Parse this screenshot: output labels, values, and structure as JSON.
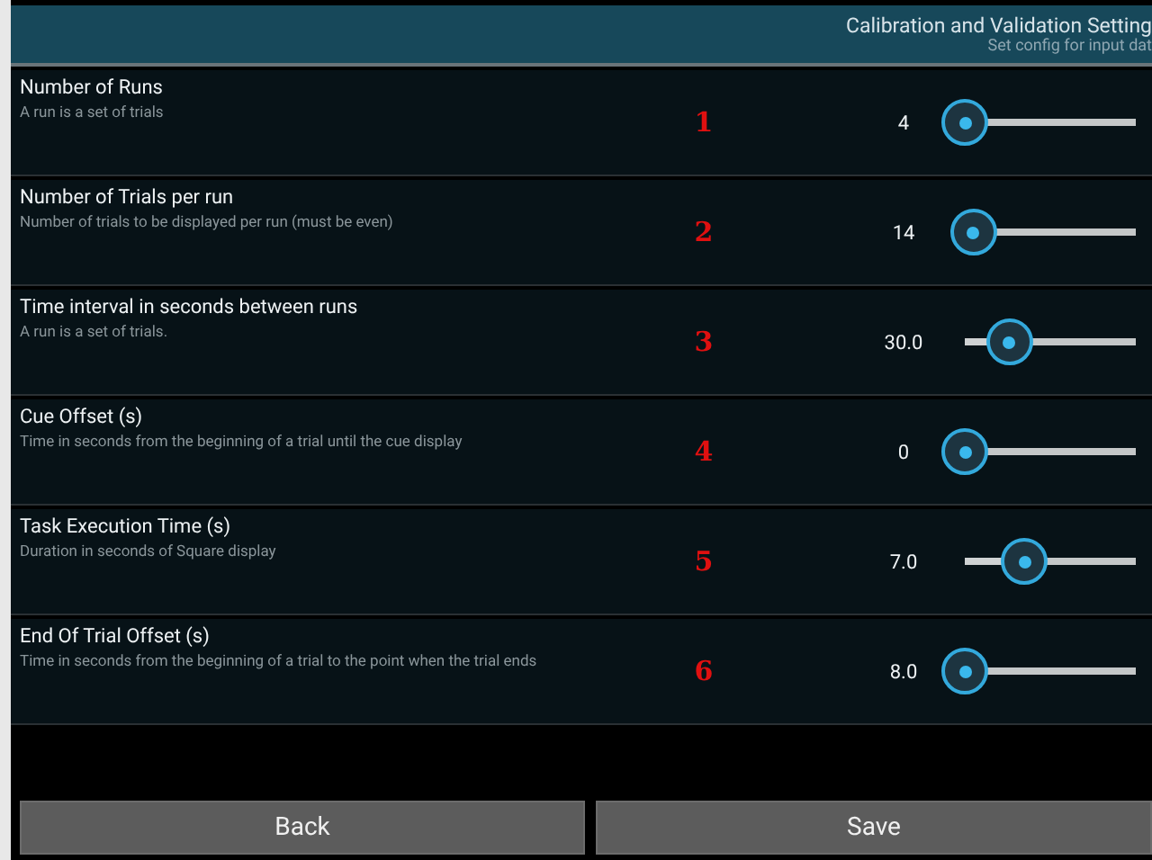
{
  "header": {
    "title": "Calibration and Validation Setting",
    "subtitle": "Set config for input dat"
  },
  "settings": [
    {
      "title": "Number of Runs",
      "description": "A run is a set of trials",
      "marker": "1",
      "value": "4",
      "level": 0
    },
    {
      "title": "Number of Trials per run",
      "description": "Number of trials to be displayed per run (must be even)",
      "marker": "2",
      "value": "14",
      "level": 0.05
    },
    {
      "title": "Time interval in seconds between runs",
      "description": "A run is a set of trials.",
      "marker": "3",
      "value": "30.0",
      "level": 0.26
    },
    {
      "title": "Cue Offset (s)",
      "description": "Time in seconds from the beginning of a trial until the cue display",
      "marker": "4",
      "value": "0",
      "level": 0
    },
    {
      "title": "Task Execution Time (s)",
      "description": "Duration in seconds of Square display",
      "marker": "5",
      "value": "7.0",
      "level": 0.35
    },
    {
      "title": "End Of Trial Offset (s)",
      "description": "Time in seconds from the beginning of a trial to the point when the trial ends",
      "marker": "6",
      "value": "8.0",
      "level": 0
    }
  ],
  "buttons": [
    "Back",
    "Save"
  ]
}
